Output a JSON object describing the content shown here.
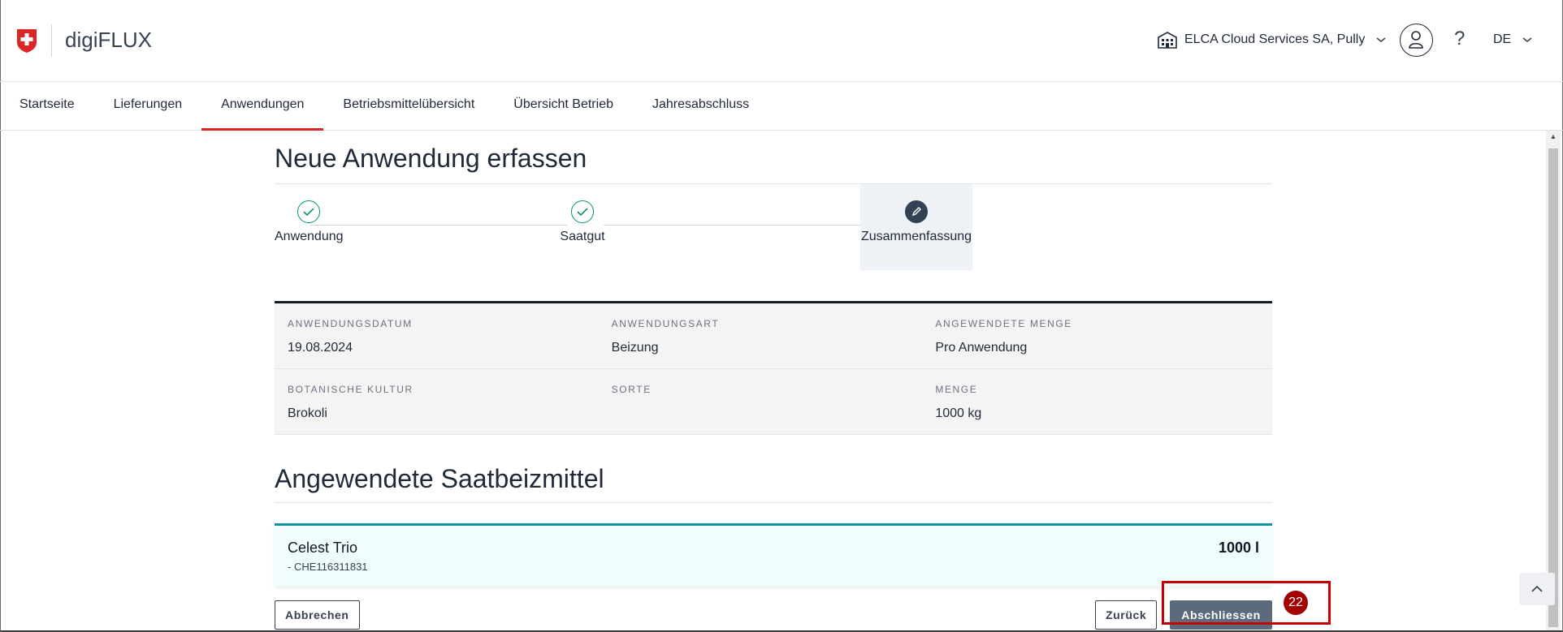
{
  "header": {
    "app_title": "digiFLUX",
    "organization": "ELCA Cloud Services SA, Pully",
    "help": "?",
    "language": "DE"
  },
  "nav": {
    "items": [
      {
        "label": "Startseite"
      },
      {
        "label": "Lieferungen"
      },
      {
        "label": "Anwendungen",
        "active": true
      },
      {
        "label": "Betriebsmittelübersicht"
      },
      {
        "label": "Übersicht Betrieb"
      },
      {
        "label": "Jahresabschluss"
      }
    ]
  },
  "page": {
    "title": "Neue Anwendung erfassen",
    "steps": [
      {
        "label": "Anwendung",
        "state": "done"
      },
      {
        "label": "Saatgut",
        "state": "done"
      },
      {
        "label": "Zusammenfassung",
        "state": "current"
      }
    ],
    "summary": {
      "rows": [
        [
          {
            "label": "ANWENDUNGSDATUM",
            "value": "19.08.2024"
          },
          {
            "label": "ANWENDUNGSART",
            "value": "Beizung"
          },
          {
            "label": "ANGEWENDETE MENGE",
            "value": "Pro Anwendung"
          }
        ],
        [
          {
            "label": "BOTANISCHE KULTUR",
            "value": "Brokoli"
          },
          {
            "label": "SORTE",
            "value": ""
          },
          {
            "label": "MENGE",
            "value": "1000 kg"
          }
        ]
      ]
    },
    "section_title": "Angewendete Saatbeizmittel",
    "product": {
      "name": "Celest Trio",
      "code": "- CHE116311831",
      "quantity": "1000 l"
    },
    "actions": {
      "cancel": "Abbrechen",
      "back": "Zurück",
      "finish": "Abschliessen"
    },
    "badge": "22"
  },
  "colors": {
    "accent_red": "#dc2626",
    "step_done": "#059669",
    "product_border": "#14919b",
    "primary_button": "#5b6b7c",
    "highlight": "#c40000"
  },
  "icons": [
    "swiss-cross-logo",
    "building-icon",
    "chevron-down-icon",
    "user-icon",
    "check-icon",
    "pencil-icon",
    "chevron-up-icon"
  ]
}
